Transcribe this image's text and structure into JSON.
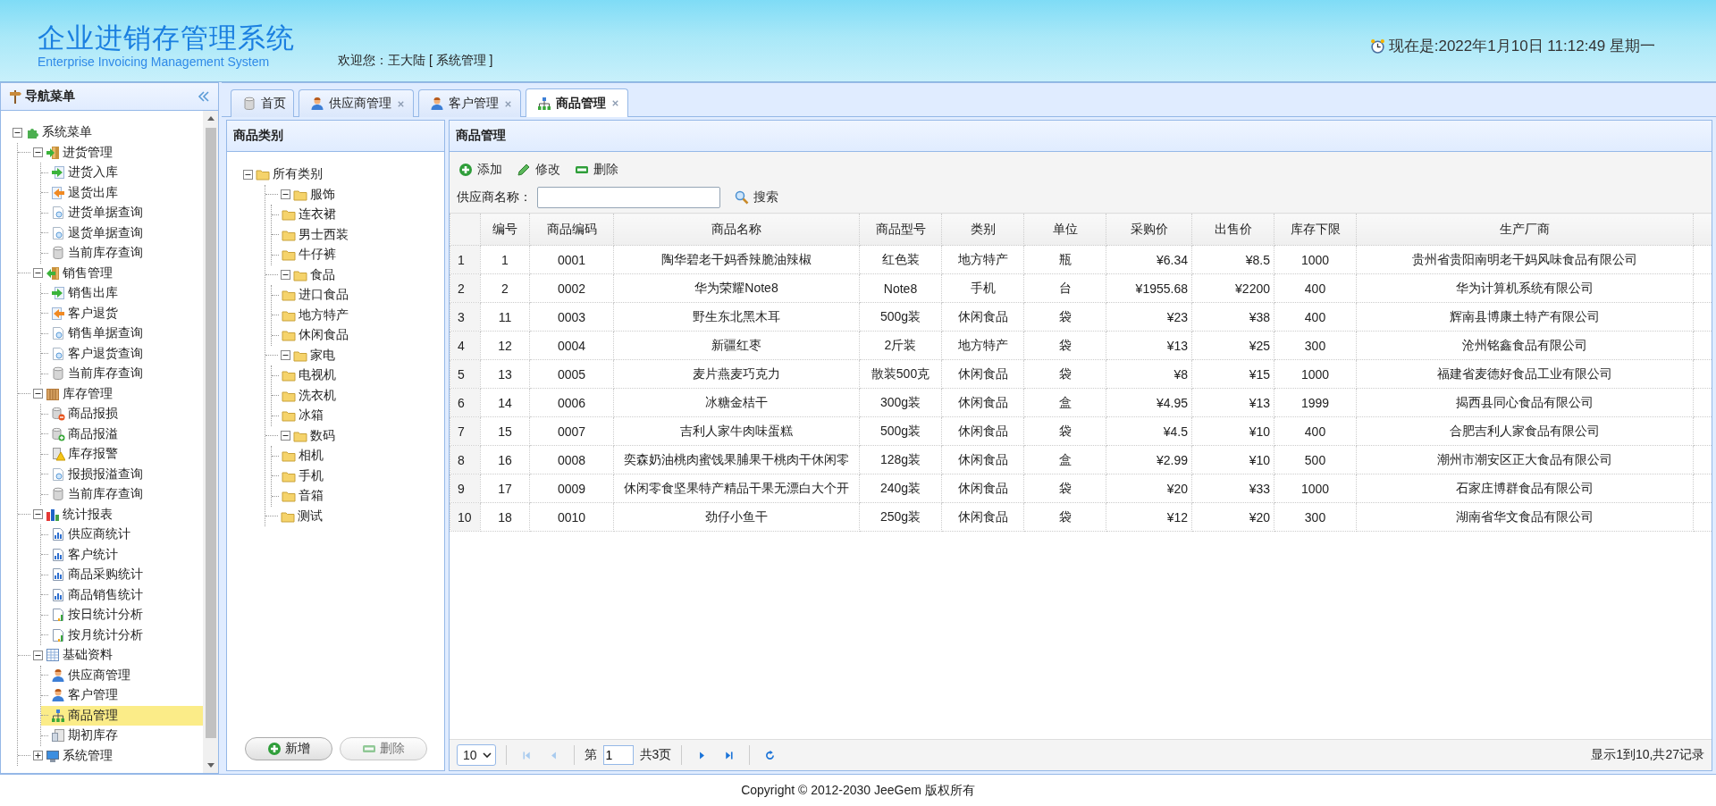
{
  "header": {
    "title": "企业进销存管理系统",
    "subtitle": "Enterprise Invoicing Management System",
    "welcome": "欢迎您：王大陆 [ 系统管理 ]",
    "clock": "现在是:2022年1月10日 11:12:49 星期一"
  },
  "nav": {
    "title": "导航菜单",
    "items": [
      {
        "label": "系统菜单",
        "kind": "root",
        "expanded": true,
        "selected": false,
        "children": [
          {
            "label": "进货管理",
            "kind": "purchase",
            "expanded": true,
            "selected": false,
            "children": [
              {
                "label": "进货入库",
                "kind": "in",
                "selected": false
              },
              {
                "label": "退货出库",
                "kind": "out",
                "selected": false
              },
              {
                "label": "进货单据查询",
                "kind": "query",
                "selected": false
              },
              {
                "label": "退货单据查询",
                "kind": "query",
                "selected": false
              },
              {
                "label": "当前库存查询",
                "kind": "db",
                "selected": false
              }
            ]
          },
          {
            "label": "销售管理",
            "kind": "sales",
            "expanded": true,
            "selected": false,
            "children": [
              {
                "label": "销售出库",
                "kind": "in",
                "selected": false
              },
              {
                "label": "客户退货",
                "kind": "out",
                "selected": false
              },
              {
                "label": "销售单据查询",
                "kind": "query",
                "selected": false
              },
              {
                "label": "客户退货查询",
                "kind": "query",
                "selected": false
              },
              {
                "label": "当前库存查询",
                "kind": "db",
                "selected": false
              }
            ]
          },
          {
            "label": "库存管理",
            "kind": "stock",
            "expanded": true,
            "selected": false,
            "children": [
              {
                "label": "商品报损",
                "kind": "loss",
                "selected": false
              },
              {
                "label": "商品报溢",
                "kind": "overflow",
                "selected": false
              },
              {
                "label": "库存报警",
                "kind": "alarm",
                "selected": false
              },
              {
                "label": "报损报溢查询",
                "kind": "query",
                "selected": false
              },
              {
                "label": "当前库存查询",
                "kind": "db",
                "selected": false
              }
            ]
          },
          {
            "label": "统计报表",
            "kind": "report",
            "expanded": true,
            "selected": false,
            "children": [
              {
                "label": "供应商统计",
                "kind": "chart",
                "selected": false
              },
              {
                "label": "客户统计",
                "kind": "chart",
                "selected": false
              },
              {
                "label": "商品采购统计",
                "kind": "chart",
                "selected": false
              },
              {
                "label": "商品销售统计",
                "kind": "chart",
                "selected": false
              },
              {
                "label": "按日统计分析",
                "kind": "chart2",
                "selected": false
              },
              {
                "label": "按月统计分析",
                "kind": "chart2",
                "selected": false
              }
            ]
          },
          {
            "label": "基础资料",
            "kind": "basic",
            "expanded": true,
            "selected": false,
            "children": [
              {
                "label": "供应商管理",
                "kind": "user",
                "selected": false
              },
              {
                "label": "客户管理",
                "kind": "user",
                "selected": false
              },
              {
                "label": "商品管理",
                "kind": "org",
                "selected": true
              },
              {
                "label": "期初库存",
                "kind": "initial",
                "selected": false
              }
            ]
          },
          {
            "label": "系统管理",
            "kind": "system",
            "expanded": false,
            "selected": false
          }
        ]
      }
    ]
  },
  "tabs": [
    {
      "label": "首页",
      "kind": "home",
      "closable": false,
      "selected": false
    },
    {
      "label": "供应商管理",
      "kind": "user",
      "closable": true,
      "selected": false
    },
    {
      "label": "客户管理",
      "kind": "user",
      "closable": true,
      "selected": false
    },
    {
      "label": "商品管理",
      "kind": "org",
      "closable": true,
      "selected": true
    }
  ],
  "category": {
    "title": "商品类别",
    "tree": [
      {
        "label": "所有类别",
        "expanded": true,
        "children": [
          {
            "label": "服饰",
            "expanded": true,
            "children": [
              {
                "label": "连衣裙"
              },
              {
                "label": "男士西装"
              },
              {
                "label": "牛仔裤"
              }
            ]
          },
          {
            "label": "食品",
            "expanded": true,
            "children": [
              {
                "label": "进口食品"
              },
              {
                "label": "地方特产"
              },
              {
                "label": "休闲食品"
              }
            ]
          },
          {
            "label": "家电",
            "expanded": true,
            "children": [
              {
                "label": "电视机"
              },
              {
                "label": "洗衣机"
              },
              {
                "label": "冰箱"
              }
            ]
          },
          {
            "label": "数码",
            "expanded": true,
            "children": [
              {
                "label": "相机"
              },
              {
                "label": "手机"
              },
              {
                "label": "音箱"
              }
            ]
          },
          {
            "label": "测试"
          }
        ]
      }
    ],
    "buttons": [
      {
        "label": "新增",
        "kind": "add",
        "disabled": false
      },
      {
        "label": "删除",
        "kind": "remove",
        "disabled": true
      }
    ]
  },
  "main": {
    "title": "商品管理",
    "toolbar": [
      {
        "label": "添加",
        "kind": "add"
      },
      {
        "label": "修改",
        "kind": "edit"
      },
      {
        "label": "删除",
        "kind": "remove"
      }
    ],
    "search": {
      "label": "供应商名称：",
      "button": "搜索"
    },
    "table": {
      "columns": [
        "编号",
        "商品编码",
        "商品名称",
        "商品型号",
        "类别",
        "单位",
        "采购价",
        "出售价",
        "库存下限",
        "生产厂商"
      ],
      "rows": [
        {
          "n": "1",
          "cells": [
            "1",
            "0001",
            "陶华碧老干妈香辣脆油辣椒",
            "红色装",
            "地方特产",
            "瓶",
            "¥6.34",
            "¥8.5",
            "1000",
            "贵州省贵阳南明老干妈风味食品有限公司"
          ]
        },
        {
          "n": "2",
          "cells": [
            "2",
            "0002",
            "华为荣耀Note8",
            "Note8",
            "手机",
            "台",
            "¥1955.68",
            "¥2200",
            "400",
            "华为计算机系统有限公司"
          ]
        },
        {
          "n": "3",
          "cells": [
            "11",
            "0003",
            "野生东北黑木耳",
            "500g装",
            "休闲食品",
            "袋",
            "¥23",
            "¥38",
            "400",
            "辉南县博康土特产有限公司"
          ]
        },
        {
          "n": "4",
          "cells": [
            "12",
            "0004",
            "新疆红枣",
            "2斤装",
            "地方特产",
            "袋",
            "¥13",
            "¥25",
            "300",
            "沧州铭鑫食品有限公司"
          ]
        },
        {
          "n": "5",
          "cells": [
            "13",
            "0005",
            "麦片燕麦巧克力",
            "散装500克",
            "休闲食品",
            "袋",
            "¥8",
            "¥15",
            "1000",
            "福建省麦德好食品工业有限公司"
          ]
        },
        {
          "n": "6",
          "cells": [
            "14",
            "0006",
            "冰糖金桔干",
            "300g装",
            "休闲食品",
            "盒",
            "¥4.95",
            "¥13",
            "1999",
            "揭西县同心食品有限公司"
          ]
        },
        {
          "n": "7",
          "cells": [
            "15",
            "0007",
            "吉利人家牛肉味蛋糕",
            "500g装",
            "休闲食品",
            "袋",
            "¥4.5",
            "¥10",
            "400",
            "合肥吉利人家食品有限公司"
          ]
        },
        {
          "n": "8",
          "cells": [
            "16",
            "0008",
            "奕森奶油桃肉蜜饯果脯果干桃肉干休闲零",
            "128g装",
            "休闲食品",
            "盒",
            "¥2.99",
            "¥10",
            "500",
            "潮州市潮安区正大食品有限公司"
          ]
        },
        {
          "n": "9",
          "cells": [
            "17",
            "0009",
            "休闲零食坚果特产精品干果无漂白大个开",
            "240g装",
            "休闲食品",
            "袋",
            "¥20",
            "¥33",
            "1000",
            "石家庄博群食品有限公司"
          ]
        },
        {
          "n": "10",
          "cells": [
            "18",
            "0010",
            "劲仔小鱼干",
            "250g装",
            "休闲食品",
            "袋",
            "¥12",
            "¥20",
            "300",
            "湖南省华文食品有限公司"
          ]
        }
      ]
    },
    "pager": {
      "page_size": "10",
      "page_prefix": "第",
      "page": "1",
      "page_suffix": "共3页",
      "summary": "显示1到10,共27记录",
      "buttons": [
        {
          "kind": "first",
          "disabled": true
        },
        {
          "kind": "prev",
          "disabled": true
        },
        {
          "kind": "next",
          "disabled": false
        },
        {
          "kind": "last",
          "disabled": false
        }
      ]
    }
  },
  "footer": "Copyright © 2012-2030 JeeGem 版权所有"
}
